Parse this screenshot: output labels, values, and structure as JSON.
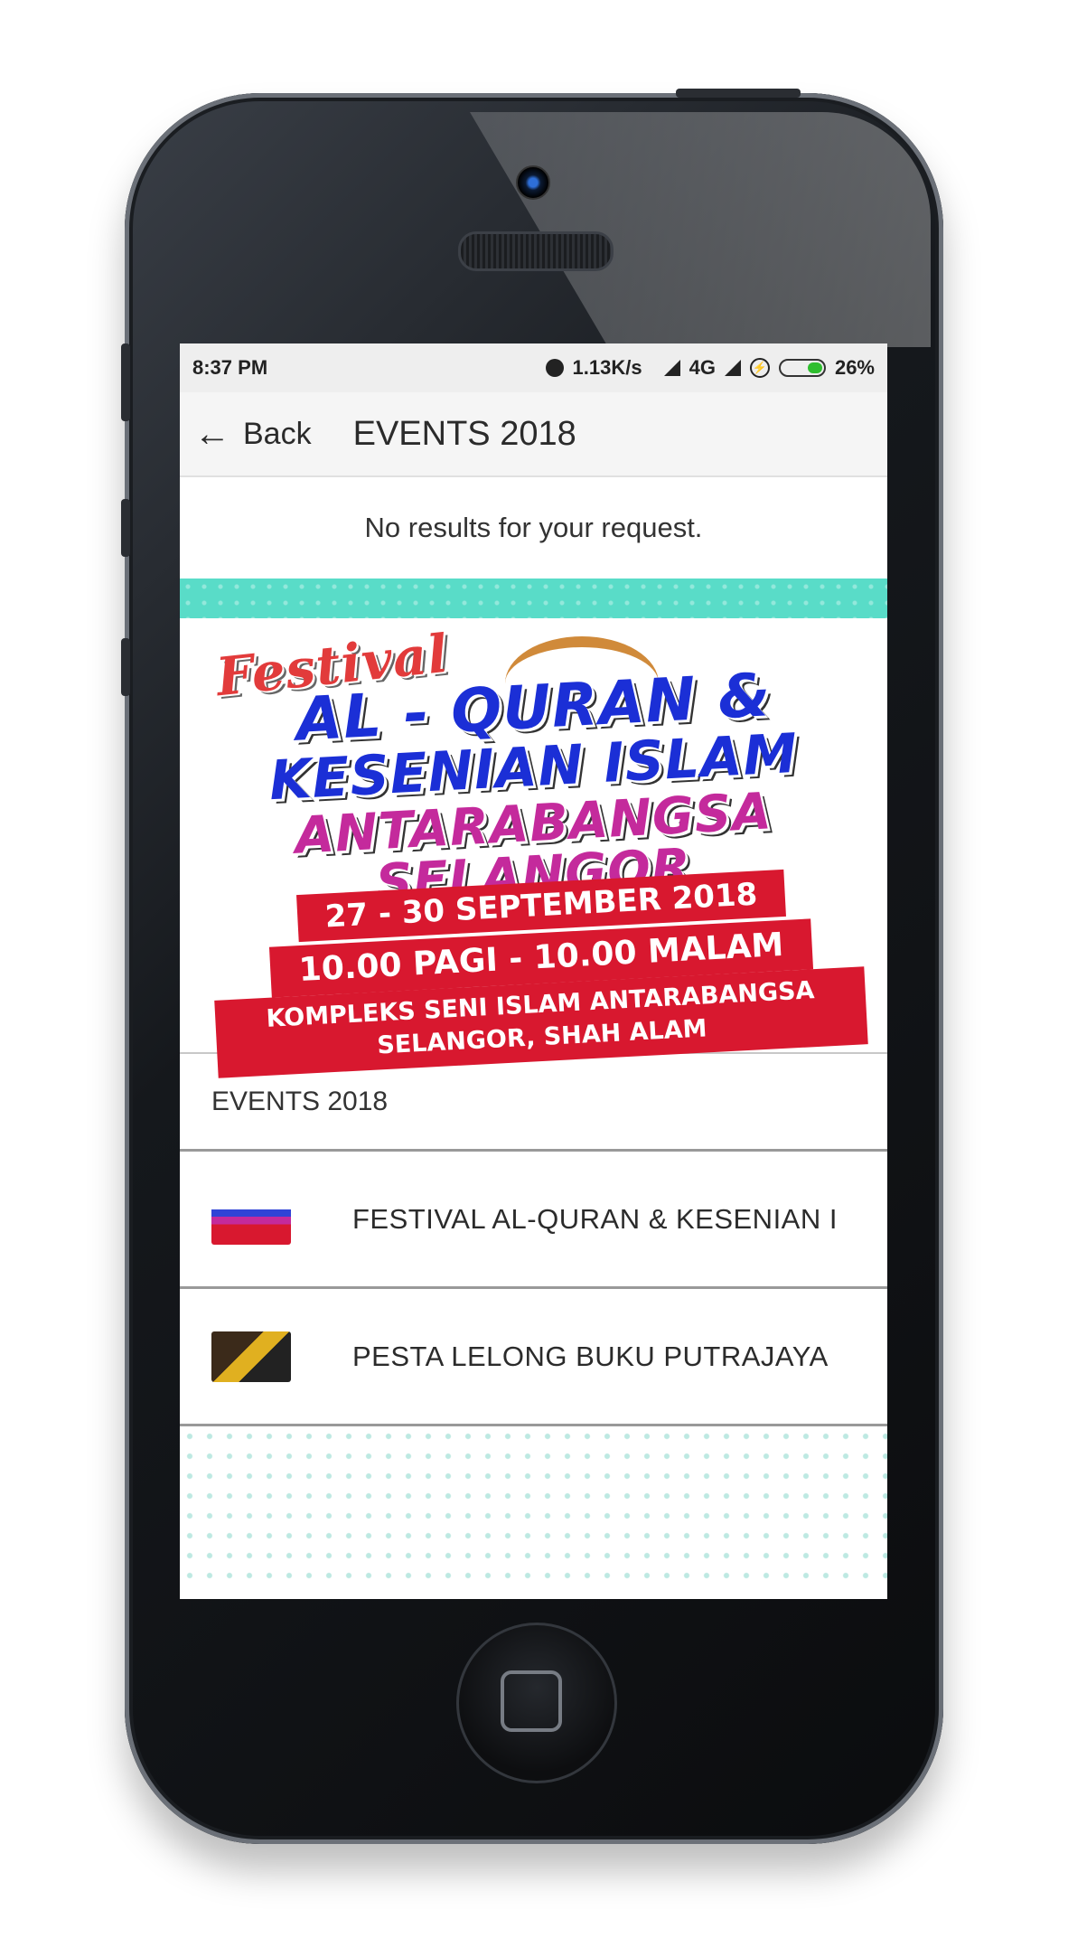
{
  "status_bar": {
    "time": "8:37 PM",
    "speed": "1.13K/s",
    "network": "4G",
    "battery": "26%",
    "battery_level": 0.26
  },
  "app_bar": {
    "back_label": "Back",
    "title": "EVENTS 2018"
  },
  "message": "No results for your request.",
  "banner": {
    "script": "Festival",
    "line1": "AL - QURAN &",
    "line2": "KESENIAN ISLAM",
    "line3": "ANTARABANGSA",
    "line4": "SELANGOR",
    "date": "27 - 30 SEPTEMBER 2018",
    "time": "10.00 PAGI - 10.00 MALAM",
    "venue_line1": "KOMPLEKS SENI ISLAM ANTARABANGSA",
    "venue_line2": "SELANGOR, SHAH ALAM"
  },
  "section": {
    "title": "EVENTS 2018"
  },
  "items": [
    {
      "label": "FESTIVAL AL-QURAN & KESENIAN I"
    },
    {
      "label": "PESTA LELONG BUKU PUTRAJAYA"
    }
  ],
  "colors": {
    "teal_band": "#59dcc8",
    "ribbon_red": "#d8182f",
    "title_blue": "#1b2fd6",
    "title_magenta": "#c42a9c"
  }
}
